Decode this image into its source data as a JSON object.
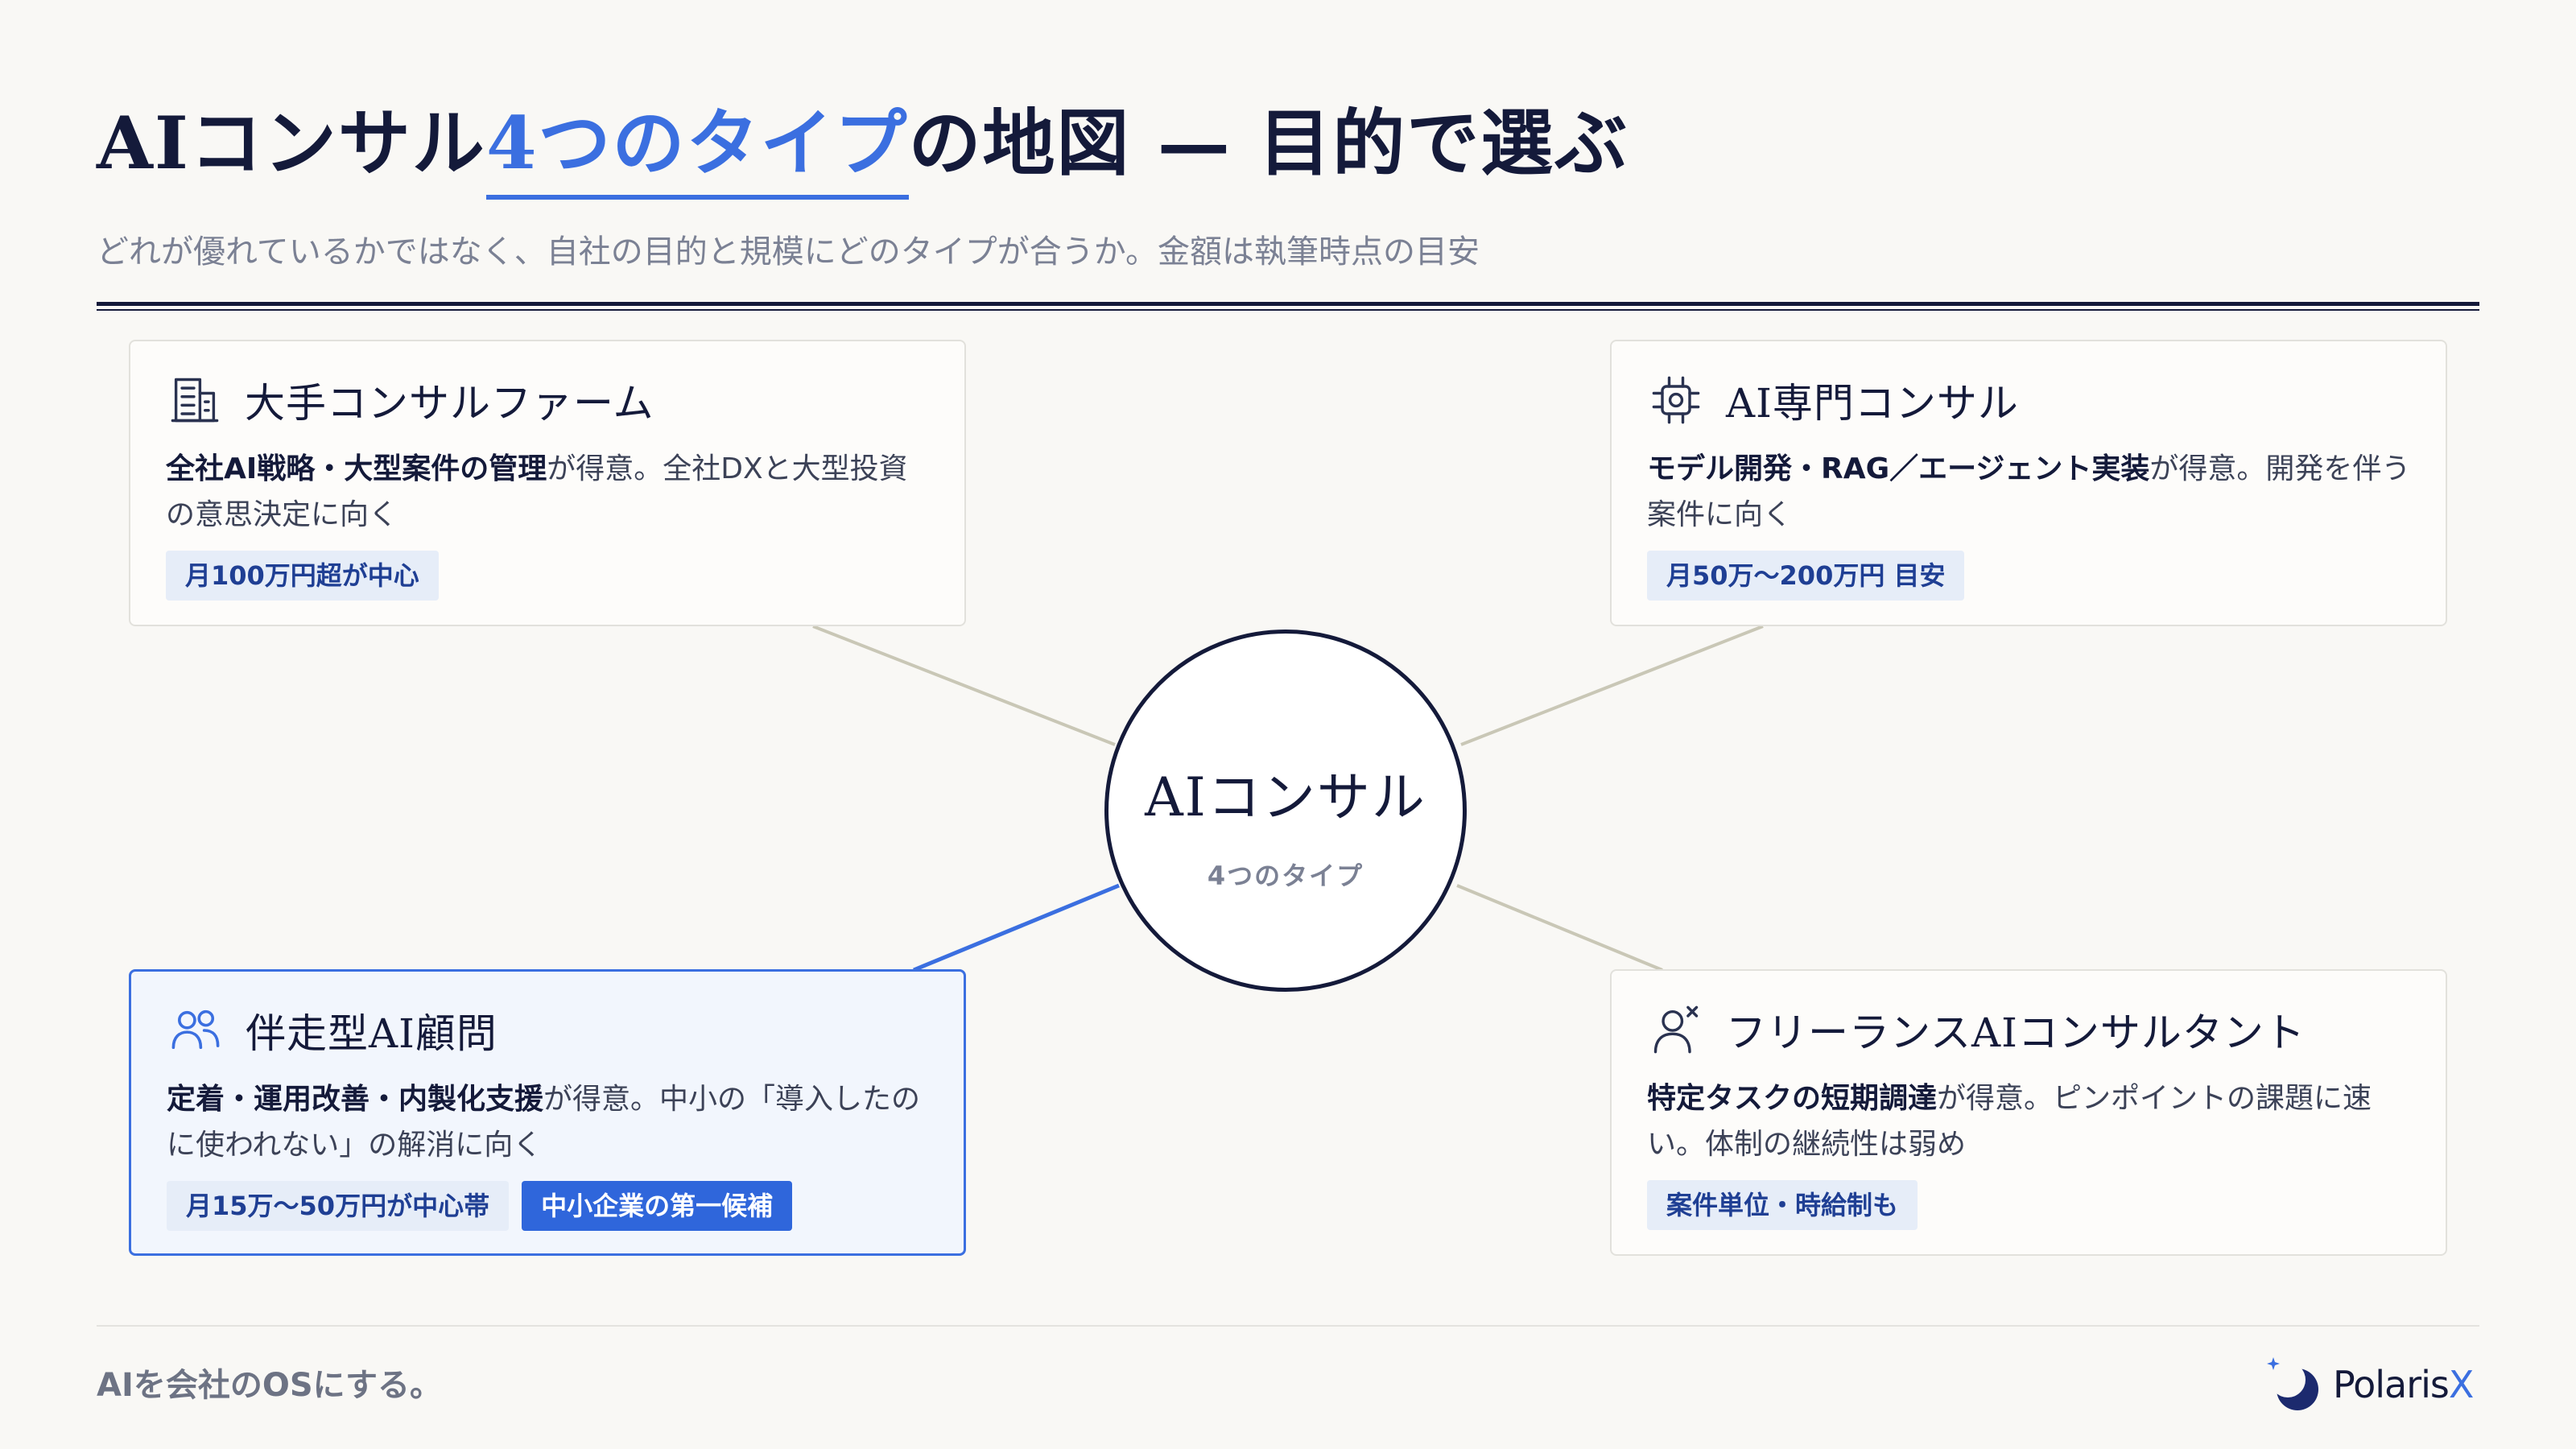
{
  "title": {
    "prefix": "AIコンサル",
    "highlight": "4つのタイプ",
    "suffix": "の地図 — 目的で選ぶ"
  },
  "subtitle": "どれが優れているかではなく、自社の目的と規模にどのタイプが合うか。金額は執筆時点の目安",
  "hub": {
    "title": "AIコンサル",
    "subtitle": "4つのタイプ"
  },
  "cards": [
    {
      "title": "大手コンサルファーム",
      "icon": "building-icon",
      "desc_bold": "全社AI戦略・大型案件の管理",
      "desc_rest": "が得意。全社DXと大型投資の意思決定に向く",
      "tags": [
        "月100万円超が中心"
      ]
    },
    {
      "title": "AI専門コンサル",
      "icon": "chip-icon",
      "desc_bold": "モデル開発・RAG／エージェント実装",
      "desc_rest": "が得意。開発を伴う案件に向く",
      "tags": [
        "月50万〜200万円 目安"
      ]
    },
    {
      "title": "伴走型AI顧問",
      "icon": "people-icon",
      "desc_bold": "定着・運用改善・内製化支援",
      "desc_rest": "が得意。中小の「導入したのに使われない」の解消に向く",
      "tags": [
        "月15万〜50万円が中心帯"
      ],
      "primary_tag": "中小企業の第一候補"
    },
    {
      "title": "フリーランスAIコンサルタント",
      "icon": "person-icon",
      "desc_bold": "特定タスクの短期調達",
      "desc_rest": "が得意。ピンポイントの課題に速い。体制の継続性は弱め",
      "tags": [
        "案件単位・時給制も"
      ]
    }
  ],
  "footer": {
    "tagline": "AIを会社のOSにする。",
    "logo_main": "Polaris",
    "logo_accent": "X"
  },
  "colors": {
    "accent": "#3b6fe0",
    "navy": "#141a3a",
    "connector": "#c9c7b6",
    "background": "#f9f8f5"
  }
}
